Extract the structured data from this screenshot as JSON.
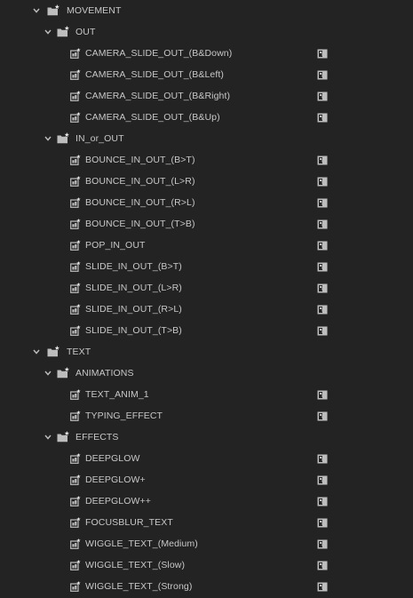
{
  "effects_tree": [
    {
      "type": "bin",
      "label": "MOVEMENT",
      "level": 0,
      "expanded": true
    },
    {
      "type": "bin",
      "label": "OUT",
      "level": 1,
      "expanded": true
    },
    {
      "type": "preset",
      "label": "CAMERA_SLIDE_OUT_(B&Down)"
    },
    {
      "type": "preset",
      "label": "CAMERA_SLIDE_OUT_(B&Left)"
    },
    {
      "type": "preset",
      "label": "CAMERA_SLIDE_OUT_(B&Right)"
    },
    {
      "type": "preset",
      "label": "CAMERA_SLIDE_OUT_(B&Up)"
    },
    {
      "type": "bin",
      "label": "IN_or_OUT",
      "level": 1,
      "expanded": true
    },
    {
      "type": "preset",
      "label": "BOUNCE_IN_OUT_(B>T)"
    },
    {
      "type": "preset",
      "label": "BOUNCE_IN_OUT_(L>R)"
    },
    {
      "type": "preset",
      "label": "BOUNCE_IN_OUT_(R>L)"
    },
    {
      "type": "preset",
      "label": "BOUNCE_IN_OUT_(T>B)"
    },
    {
      "type": "preset",
      "label": "POP_IN_OUT"
    },
    {
      "type": "preset",
      "label": "SLIDE_IN_OUT_(B>T)"
    },
    {
      "type": "preset",
      "label": "SLIDE_IN_OUT_(L>R)"
    },
    {
      "type": "preset",
      "label": "SLIDE_IN_OUT_(R>L)"
    },
    {
      "type": "preset",
      "label": "SLIDE_IN_OUT_(T>B)"
    },
    {
      "type": "bin",
      "label": "TEXT",
      "level": 0,
      "expanded": true
    },
    {
      "type": "bin",
      "label": "ANIMATIONS",
      "level": 1,
      "expanded": true
    },
    {
      "type": "preset",
      "label": "TEXT_ANIM_1"
    },
    {
      "type": "preset",
      "label": "TYPING_EFFECT"
    },
    {
      "type": "bin",
      "label": "EFFECTS",
      "level": 1,
      "expanded": true
    },
    {
      "type": "preset",
      "label": "DEEPGLOW"
    },
    {
      "type": "preset",
      "label": "DEEPGLOW+"
    },
    {
      "type": "preset",
      "label": "DEEPGLOW++"
    },
    {
      "type": "preset",
      "label": "FOCUSBLUR_TEXT"
    },
    {
      "type": "preset",
      "label": "WIGGLE_TEXT_(Medium)"
    },
    {
      "type": "preset",
      "label": "WIGGLE_TEXT_(Slow)"
    },
    {
      "type": "preset",
      "label": "WIGGLE_TEXT_(Strong)"
    }
  ],
  "icons": {
    "expanded": "chevron-down-icon",
    "bin": "preset-bin-icon",
    "preset": "effect-preset-icon",
    "apply": "accelerated-effect-icon"
  },
  "colors": {
    "background": "#232323",
    "text": "#c8c8c8",
    "icon": "#bdbdbd"
  }
}
